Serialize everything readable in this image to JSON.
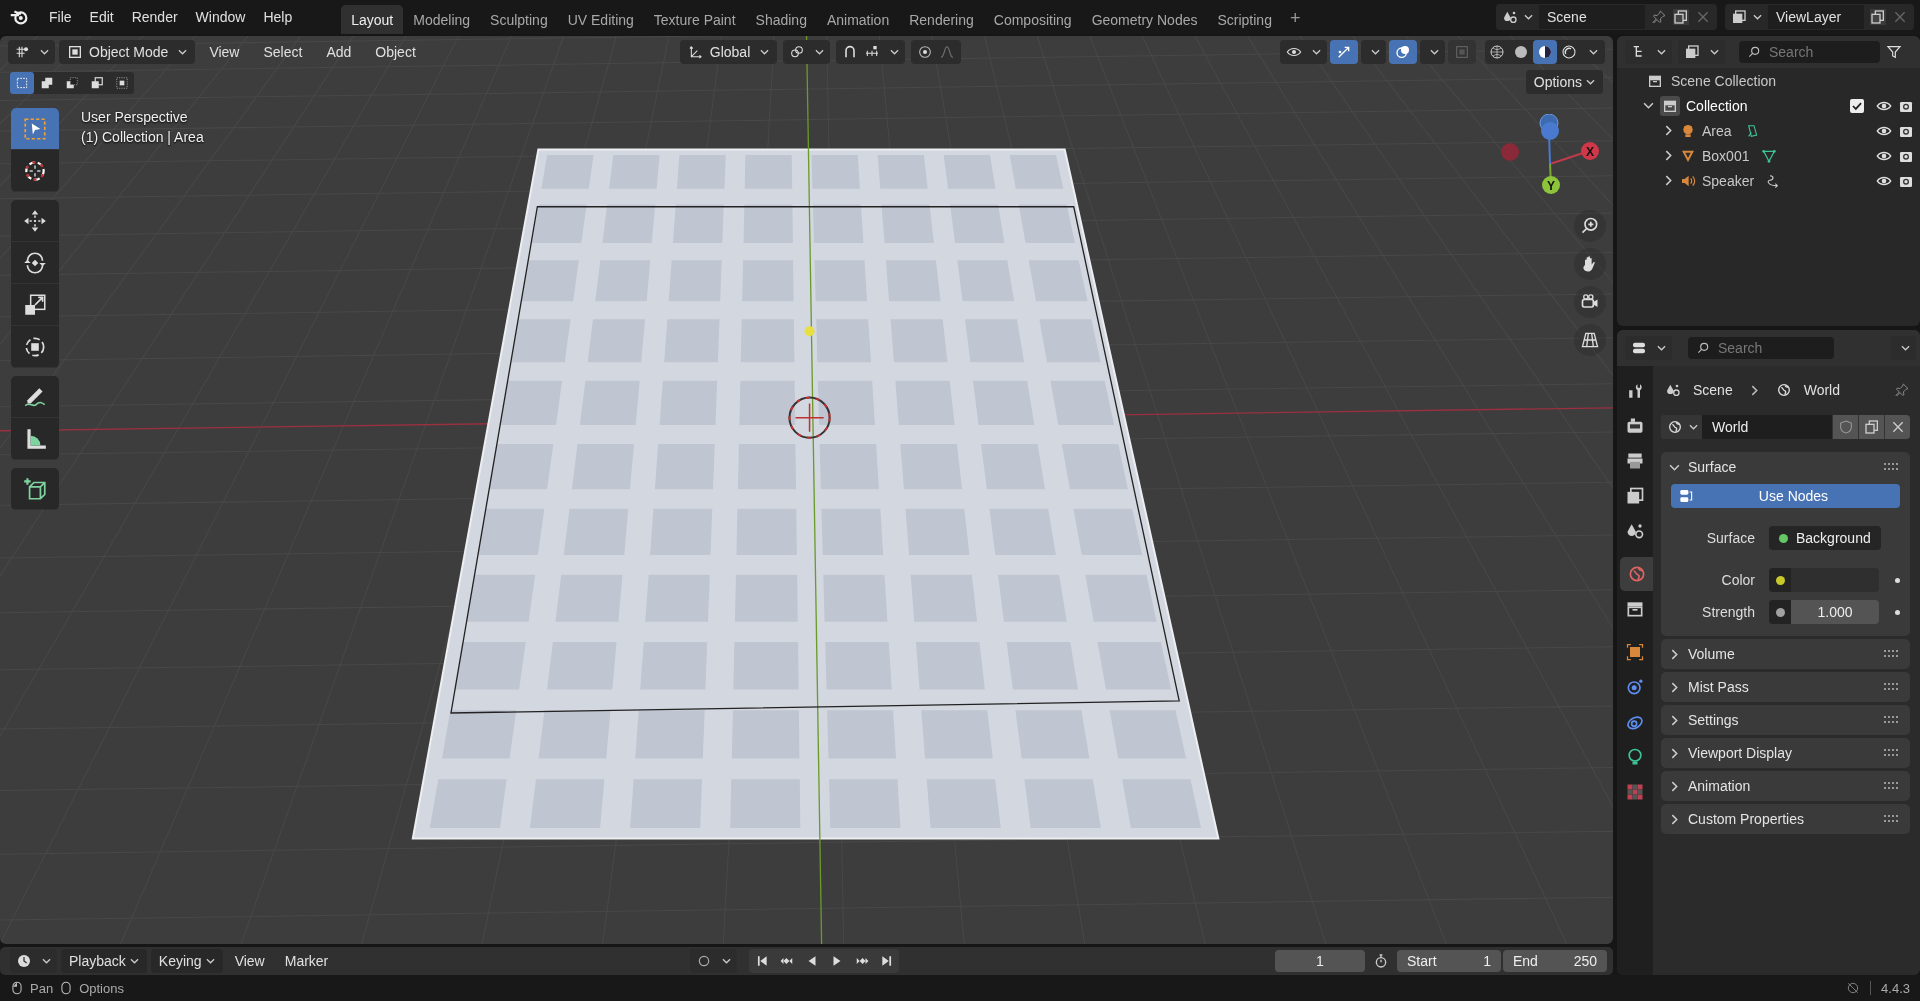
{
  "menu": [
    "File",
    "Edit",
    "Render",
    "Window",
    "Help"
  ],
  "workspaces": [
    {
      "label": "Layout",
      "selected": true
    },
    {
      "label": "Modeling",
      "selected": false
    },
    {
      "label": "Sculpting",
      "selected": false
    },
    {
      "label": "UV Editing",
      "selected": false
    },
    {
      "label": "Texture Paint",
      "selected": false
    },
    {
      "label": "Shading",
      "selected": false
    },
    {
      "label": "Animation",
      "selected": false
    },
    {
      "label": "Rendering",
      "selected": false
    },
    {
      "label": "Compositing",
      "selected": false
    },
    {
      "label": "Geometry Nodes",
      "selected": false
    },
    {
      "label": "Scripting",
      "selected": false
    }
  ],
  "add_workspace": "+",
  "scene": "Scene",
  "view_layer": "ViewLayer",
  "viewport": {
    "mode": "Object Mode",
    "menus": [
      "View",
      "Select",
      "Add",
      "Object"
    ],
    "orientation": "Global",
    "options": "Options",
    "gizmos_on": true,
    "overlays_on": true,
    "shading": [
      {
        "kind": "wireframe",
        "selected": false
      },
      {
        "kind": "solid",
        "selected": false
      },
      {
        "kind": "material",
        "selected": true
      },
      {
        "kind": "rendered",
        "selected": false
      }
    ],
    "select_modes": [
      {
        "kind": "new",
        "selected": true
      },
      {
        "kind": "extend",
        "selected": false
      },
      {
        "kind": "subtract",
        "selected": false
      },
      {
        "kind": "invert",
        "selected": false
      },
      {
        "kind": "intersect",
        "selected": false
      }
    ],
    "tool_groups": [
      [
        {
          "kind": "select",
          "selected": true
        },
        {
          "kind": "cursor",
          "selected": false
        }
      ],
      [
        {
          "kind": "move",
          "selected": false
        },
        {
          "kind": "rotate",
          "selected": false
        },
        {
          "kind": "scale",
          "selected": false
        },
        {
          "kind": "transform",
          "selected": false
        }
      ],
      [
        {
          "kind": "annotate",
          "selected": false
        },
        {
          "kind": "measure",
          "selected": false
        }
      ],
      [
        {
          "kind": "add_cube",
          "selected": false
        }
      ]
    ],
    "overlay_text": [
      "User Perspective",
      "(1) Collection | Area"
    ],
    "gizmo": {
      "x": "X",
      "y": "Y"
    }
  },
  "outliner": {
    "search_placeholder": "Search",
    "root": "Scene Collection",
    "tree": [
      {
        "label": "Collection",
        "kind": "collection",
        "expanded": true,
        "checked": true,
        "children": [
          {
            "label": "Area",
            "kind": "light",
            "expanded": false
          },
          {
            "label": "Box001",
            "kind": "mesh",
            "expanded": false
          },
          {
            "label": "Speaker",
            "kind": "speaker",
            "expanded": false
          }
        ]
      }
    ]
  },
  "properties": {
    "search_placeholder": "Search",
    "breadcrumb": [
      "Scene",
      "World"
    ],
    "datablock": "World",
    "tabs": [
      {
        "kind": "tool",
        "selected": false
      },
      {
        "kind": "render",
        "selected": false
      },
      {
        "kind": "output",
        "selected": false
      },
      {
        "kind": "view_layer",
        "selected": false
      },
      {
        "kind": "scene",
        "selected": false
      },
      {
        "kind": "world",
        "selected": true
      },
      {
        "kind": "collection",
        "selected": false
      },
      {
        "kind": "object",
        "selected": false
      },
      {
        "kind": "physics",
        "selected": false
      },
      {
        "kind": "constraints",
        "selected": false
      },
      {
        "kind": "light_data",
        "selected": false
      },
      {
        "kind": "texture",
        "selected": false
      }
    ],
    "panels": [
      {
        "title": "Surface",
        "expanded": true
      },
      {
        "title": "Volume",
        "expanded": false
      },
      {
        "title": "Mist Pass",
        "expanded": false
      },
      {
        "title": "Settings",
        "expanded": false
      },
      {
        "title": "Viewport Display",
        "expanded": false
      },
      {
        "title": "Animation",
        "expanded": false
      },
      {
        "title": "Custom Properties",
        "expanded": false
      }
    ],
    "use_nodes": "Use Nodes",
    "fields": [
      {
        "label": "Surface",
        "kind": "shader",
        "value": "Background",
        "color": "#63c763"
      },
      {
        "label": "Color",
        "kind": "color",
        "color": "#c8c82a"
      },
      {
        "label": "Strength",
        "kind": "value",
        "value": "1.000",
        "color": "#a1a1a1"
      }
    ]
  },
  "timeline": {
    "menus": [
      "Playback",
      "Keying",
      "View",
      "Marker"
    ],
    "frame": "1",
    "start_label": "Start",
    "start": "1",
    "end_label": "End",
    "end": "250"
  },
  "status": {
    "items": [
      "Pan",
      "Options"
    ],
    "version": "4.4.3"
  }
}
